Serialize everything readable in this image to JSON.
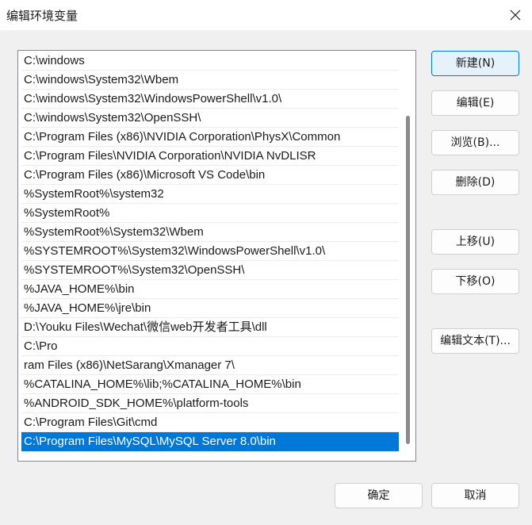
{
  "window": {
    "title": "编辑环境变量"
  },
  "path_entries": [
    "C:\\windows",
    "C:\\windows\\System32\\Wbem",
    "C:\\windows\\System32\\WindowsPowerShell\\v1.0\\",
    "C:\\windows\\System32\\OpenSSH\\",
    "C:\\Program Files (x86)\\NVIDIA Corporation\\PhysX\\Common",
    "C:\\Program Files\\NVIDIA Corporation\\NVIDIA NvDLISR",
    "C:\\Program Files (x86)\\Microsoft VS Code\\bin",
    "%SystemRoot%\\system32",
    "%SystemRoot%",
    "%SystemRoot%\\System32\\Wbem",
    "%SYSTEMROOT%\\System32\\WindowsPowerShell\\v1.0\\",
    "%SYSTEMROOT%\\System32\\OpenSSH\\",
    "%JAVA_HOME%\\bin",
    "%JAVA_HOME%\\jre\\bin",
    "D:\\Youku Files\\Wechat\\微信web开发者工具\\dll",
    "C:\\Pro",
    "ram Files (x86)\\NetSarang\\Xmanager 7\\",
    "%CATALINA_HOME%\\lib;%CATALINA_HOME%\\bin",
    "%ANDROID_SDK_HOME%\\platform-tools",
    "C:\\Program Files\\Git\\cmd",
    "C:\\Program Files\\MySQL\\MySQL Server 8.0\\bin"
  ],
  "selected_index": 20,
  "buttons": {
    "new": "新建(N)",
    "edit": "编辑(E)",
    "browse": "浏览(B)...",
    "delete": "删除(D)",
    "move_up": "上移(U)",
    "move_down": "下移(O)",
    "edit_text": "编辑文本(T)...",
    "ok": "确定",
    "cancel": "取消"
  },
  "colors": {
    "selection": "#0078d7",
    "default_button_border": "#0078d7",
    "default_button_fill": "#e5f1fb"
  },
  "icons": {
    "close": "close-icon"
  }
}
